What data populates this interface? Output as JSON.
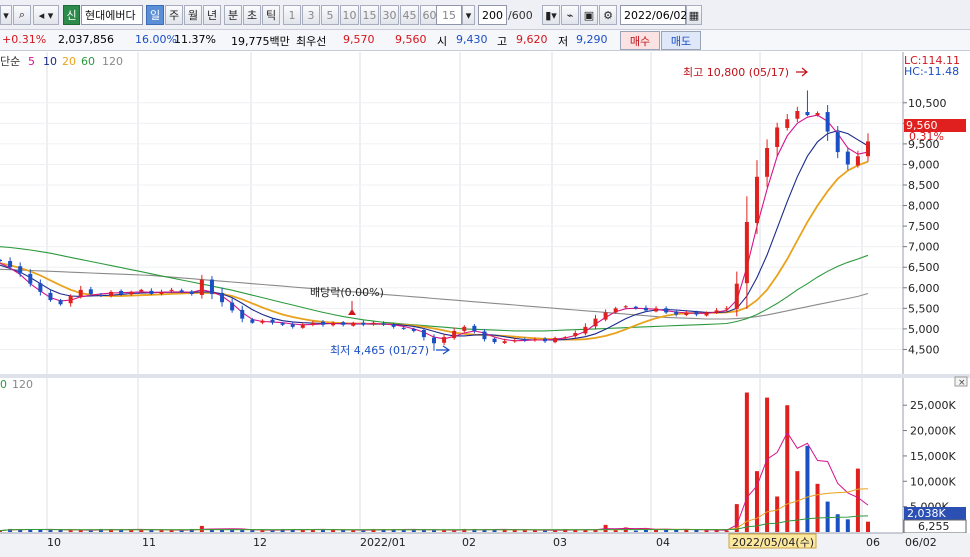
{
  "toolbar": {
    "stock_badge": "신",
    "stock_name": "현대에버다",
    "period_tabs": [
      "일",
      "주",
      "월",
      "년",
      "분",
      "초",
      "틱"
    ],
    "minute_options": [
      "1",
      "3",
      "5",
      "10",
      "15",
      "30",
      "45",
      "60"
    ],
    "interval_value": "15",
    "count_value": "200",
    "count_total": "/600",
    "date_value": "2022/06/02"
  },
  "quote": {
    "change_rate": "+0.31%",
    "volume": "2,037,856",
    "rate1": "16.00%",
    "rate2": "11.37%",
    "amount": "19,775백만",
    "priority_label": "최우선",
    "ask": "9,570",
    "bid": "9,560",
    "open_label": "시",
    "open": "9,430",
    "high_label": "고",
    "high": "9,620",
    "low_label": "저",
    "low": "9,290",
    "buy_label": "매수",
    "sell_label": "매도"
  },
  "price_panel": {
    "legend_label": "단순",
    "ma_periods": [
      "5",
      "10",
      "20",
      "60",
      "120"
    ],
    "ma_colors": [
      "#d4148c",
      "#1a2a8c",
      "#e9a21c",
      "#2c9a3c",
      "#8a8a8a"
    ],
    "lc": "LC:114.11",
    "hc": "HC:-11.48",
    "current_price": "9,560",
    "current_change": "0.31%",
    "annotation_high": "최고 10,800 (05/17)",
    "annotation_low": "최저 4,465 (01/27)",
    "annotation_dividend": "배당락(0.00%)"
  },
  "volume_panel": {
    "legend_suffix": "0",
    "legend_period": "120",
    "current_volume": "2,038K",
    "ma_volume": "6,255"
  },
  "x_labels": [
    "10",
    "11",
    "12",
    "2022/01",
    "02",
    "03",
    "04",
    "2022/05/04(수)",
    "06",
    "06/02"
  ],
  "chart_data": {
    "type": "candlestick",
    "price_axis_ticks": [
      10500,
      10000,
      9500,
      9000,
      8500,
      8000,
      7500,
      7000,
      6500,
      6000,
      5500,
      5000,
      4500
    ],
    "price_axis_labels": [
      "10,500",
      "10,000",
      "9,500",
      "9,000",
      "8,500",
      "8,000",
      "7,500",
      "7,000",
      "6,500",
      "6,000",
      "5,500",
      "5,000",
      "4,500"
    ],
    "volume_axis_ticks": [
      25000,
      20000,
      15000,
      10000,
      5000
    ],
    "volume_axis_labels": [
      "25,000K",
      "20,000K",
      "15,000K",
      "10,000K",
      "5,000K"
    ],
    "ylim_price": [
      4000,
      11200
    ],
    "ylim_volume": [
      0,
      28000
    ],
    "highest": 10800,
    "lowest": 4465,
    "last_close": 9560,
    "close_path": [
      6650,
      6500,
      6350,
      6100,
      5900,
      5700,
      5600,
      5800,
      5950,
      5850,
      5800,
      5900,
      5850,
      5900,
      5950,
      5850,
      5900,
      5950,
      5900,
      5850,
      6200,
      5850,
      5650,
      5450,
      5250,
      5150,
      5200,
      5150,
      5100,
      5050,
      5100,
      5150,
      5100,
      5150,
      5100,
      5150,
      5100,
      5150,
      5100,
      5050,
      5000,
      4950,
      4800,
      4650,
      4800,
      4950,
      5050,
      4950,
      4750,
      4680,
      4700,
      4720,
      4730,
      4750,
      4700,
      4780,
      4800,
      4900,
      5050,
      5250,
      5400,
      5500,
      5550,
      5500,
      5450,
      5500,
      5400,
      5350,
      5400,
      5350,
      5400,
      5450,
      5500,
      6100,
      7600,
      8700,
      9400,
      9900,
      10100,
      10300,
      10200,
      10250,
      9800,
      9300,
      9000,
      9200,
      9560
    ],
    "ma5": [
      6600,
      6480,
      6320,
      6100,
      5920,
      5760,
      5680,
      5700,
      5780,
      5820,
      5850,
      5870,
      5880,
      5890,
      5900,
      5890,
      5890,
      5900,
      5900,
      5890,
      5950,
      5900,
      5800,
      5620,
      5400,
      5230,
      5180,
      5170,
      5150,
      5120,
      5100,
      5110,
      5120,
      5130,
      5120,
      5130,
      5120,
      5130,
      5120,
      5100,
      5060,
      5000,
      4920,
      4800,
      4760,
      4820,
      4900,
      4950,
      4900,
      4800,
      4740,
      4710,
      4720,
      4730,
      4730,
      4750,
      4780,
      4840,
      4940,
      5120,
      5280,
      5420,
      5490,
      5500,
      5490,
      5480,
      5440,
      5410,
      5390,
      5380,
      5380,
      5410,
      5450,
      5700,
      6500,
      7500,
      8400,
      9200,
      9700,
      10000,
      10150,
      10200,
      10050,
      9750,
      9400,
      9250,
      9300
    ],
    "ma10": [
      6550,
      6470,
      6380,
      6250,
      6100,
      5950,
      5850,
      5800,
      5790,
      5800,
      5810,
      5820,
      5840,
      5860,
      5870,
      5880,
      5890,
      5890,
      5890,
      5890,
      5900,
      5900,
      5850,
      5760,
      5620,
      5470,
      5350,
      5260,
      5200,
      5170,
      5150,
      5140,
      5130,
      5130,
      5130,
      5120,
      5120,
      5120,
      5120,
      5110,
      5090,
      5060,
      5010,
      4940,
      4870,
      4830,
      4830,
      4850,
      4860,
      4850,
      4810,
      4770,
      4740,
      4730,
      4730,
      4730,
      4740,
      4770,
      4810,
      4880,
      4990,
      5120,
      5250,
      5350,
      5420,
      5460,
      5470,
      5460,
      5440,
      5420,
      5400,
      5400,
      5410,
      5500,
      5800,
      6250,
      6800,
      7450,
      8100,
      8700,
      9200,
      9550,
      9750,
      9820,
      9750,
      9600,
      9450
    ],
    "ma20": [
      6600,
      6550,
      6480,
      6400,
      6300,
      6180,
      6060,
      5950,
      5870,
      5830,
      5810,
      5800,
      5800,
      5810,
      5820,
      5830,
      5840,
      5850,
      5860,
      5870,
      5880,
      5870,
      5850,
      5800,
      5720,
      5620,
      5520,
      5430,
      5350,
      5290,
      5240,
      5200,
      5170,
      5150,
      5140,
      5130,
      5130,
      5120,
      5120,
      5110,
      5100,
      5080,
      5050,
      5010,
      4960,
      4910,
      4880,
      4860,
      4850,
      4840,
      4830,
      4810,
      4790,
      4770,
      4760,
      4750,
      4740,
      4740,
      4750,
      4780,
      4830,
      4900,
      4990,
      5090,
      5180,
      5260,
      5320,
      5360,
      5380,
      5390,
      5390,
      5390,
      5400,
      5430,
      5520,
      5700,
      5950,
      6300,
      6700,
      7150,
      7600,
      8000,
      8350,
      8650,
      8850,
      8980,
      9070
    ],
    "ma60": [
      7000,
      6980,
      6950,
      6920,
      6880,
      6840,
      6790,
      6740,
      6690,
      6640,
      6590,
      6540,
      6490,
      6440,
      6390,
      6340,
      6290,
      6240,
      6190,
      6140,
      6090,
      6040,
      5990,
      5940,
      5880,
      5820,
      5760,
      5700,
      5640,
      5580,
      5520,
      5460,
      5400,
      5350,
      5300,
      5260,
      5220,
      5190,
      5160,
      5140,
      5120,
      5100,
      5080,
      5060,
      5040,
      5020,
      5000,
      4990,
      4980,
      4970,
      4960,
      4950,
      4950,
      4950,
      4950,
      4960,
      4970,
      4980,
      4990,
      5000,
      5010,
      5020,
      5030,
      5040,
      5050,
      5060,
      5070,
      5080,
      5090,
      5100,
      5110,
      5120,
      5130,
      5180,
      5250,
      5350,
      5480,
      5620,
      5780,
      5950,
      6100,
      6260,
      6400,
      6520,
      6620,
      6700,
      6790
    ],
    "ma120": [
      6450,
      6440,
      6430,
      6420,
      6410,
      6400,
      6390,
      6380,
      6370,
      6360,
      6350,
      6340,
      6330,
      6320,
      6310,
      6300,
      6280,
      6260,
      6240,
      6220,
      6200,
      6180,
      6160,
      6140,
      6120,
      6100,
      6080,
      6060,
      6040,
      6020,
      6000,
      5980,
      5960,
      5940,
      5920,
      5900,
      5880,
      5860,
      5840,
      5820,
      5800,
      5780,
      5760,
      5740,
      5720,
      5700,
      5680,
      5660,
      5640,
      5620,
      5600,
      5580,
      5560,
      5540,
      5520,
      5500,
      5480,
      5460,
      5440,
      5420,
      5400,
      5380,
      5360,
      5340,
      5320,
      5300,
      5280,
      5270,
      5260,
      5250,
      5240,
      5240,
      5240,
      5250,
      5270,
      5300,
      5340,
      5390,
      5440,
      5490,
      5540,
      5590,
      5640,
      5690,
      5740,
      5790,
      5860
    ],
    "volume_spikes": [
      {
        "i": 20,
        "v": 1200
      },
      {
        "i": 55,
        "v": 300
      },
      {
        "i": 60,
        "v": 1400
      },
      {
        "i": 62,
        "v": 900
      },
      {
        "i": 73,
        "v": 5500
      },
      {
        "i": 74,
        "v": 27500
      },
      {
        "i": 75,
        "v": 12000
      },
      {
        "i": 76,
        "v": 26500
      },
      {
        "i": 77,
        "v": 7000
      },
      {
        "i": 78,
        "v": 25000
      },
      {
        "i": 79,
        "v": 12000
      },
      {
        "i": 80,
        "v": 17000
      },
      {
        "i": 81,
        "v": 9500
      },
      {
        "i": 82,
        "v": 6000
      },
      {
        "i": 83,
        "v": 3500
      },
      {
        "i": 84,
        "v": 2500
      },
      {
        "i": 85,
        "v": 12500
      },
      {
        "i": 86,
        "v": 2038
      }
    ]
  }
}
